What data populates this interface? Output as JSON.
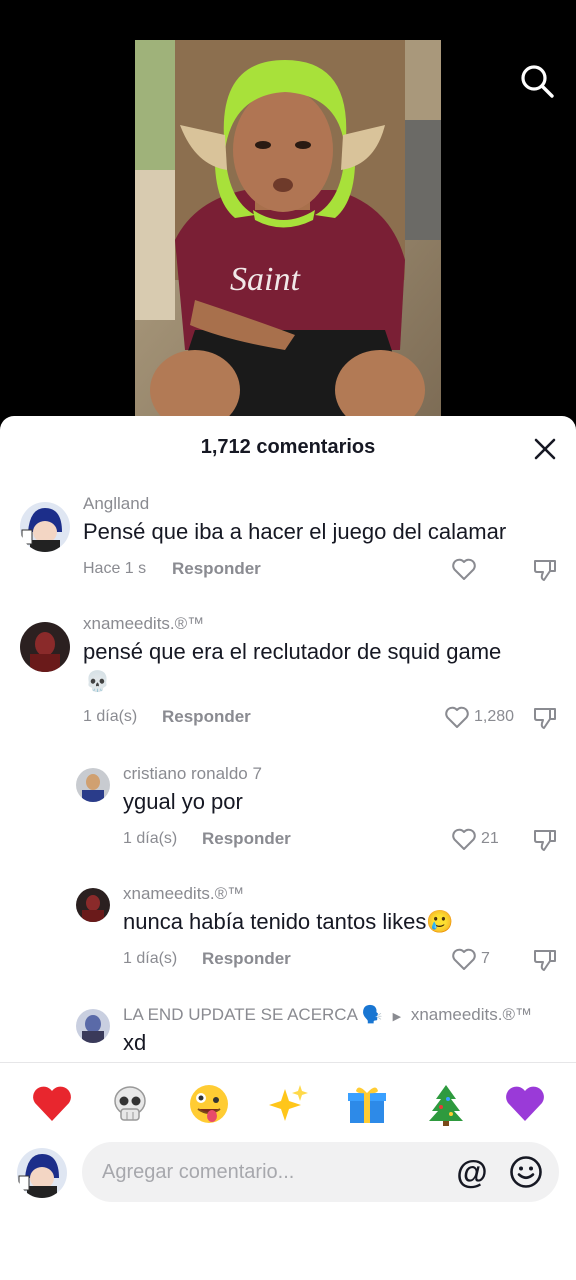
{
  "video": {
    "shirt_text": "Saint"
  },
  "sheet": {
    "title": "1,712 comentarios"
  },
  "comments": [
    {
      "user": "Anglland",
      "text": "Pensé que iba a hacer el juego del calamar",
      "time": "Hace 1 s",
      "reply_label": "Responder",
      "likes": ""
    },
    {
      "user": "xnameedits.®™",
      "text": "pensé que era el reclutador de squid game",
      "emoji": "💀",
      "time": "1 día(s)",
      "reply_label": "Responder",
      "likes": "1,280"
    }
  ],
  "replies": [
    {
      "user": "cristiano ronaldo 7",
      "text": "ygual yo por",
      "time": "1 día(s)",
      "reply_label": "Responder",
      "likes": "21"
    },
    {
      "user": "xnameedits.®™",
      "text": "nunca había tenido tantos likes🥲",
      "time": "1 día(s)",
      "reply_label": "Responder",
      "likes": "7"
    },
    {
      "user": "LA END UPDATE SE ACERCA",
      "user_emoji": "🗣️",
      "reply_to": "xnameedits.®™",
      "text": "xd"
    }
  ],
  "emoji_bar": [
    "❤️",
    "💀",
    "🤪",
    "✨",
    "🎁",
    "🎄",
    "💜"
  ],
  "input": {
    "placeholder": "Agregar comentario...",
    "at_symbol": "@"
  },
  "colors": {
    "text_primary": "#161823",
    "text_secondary": "#8a8b91",
    "input_bg": "#f1f1f2"
  }
}
